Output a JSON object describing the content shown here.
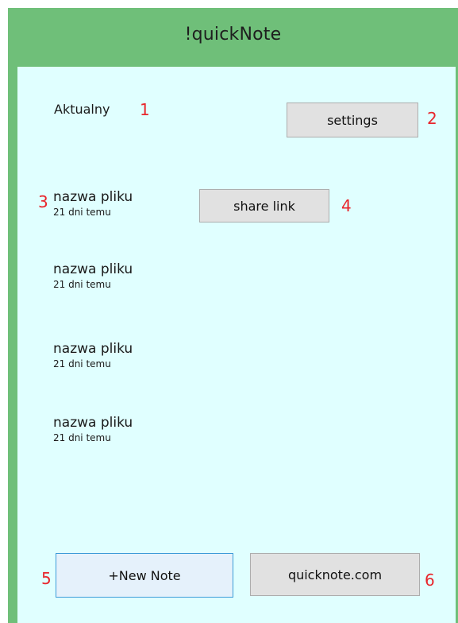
{
  "window": {
    "title": "!quickNote"
  },
  "header": {
    "current_label": "Aktualny",
    "settings_label": "settings"
  },
  "files": [
    {
      "name": "nazwa pliku",
      "date": "21 dni temu"
    },
    {
      "name": "nazwa pliku",
      "date": "21 dni temu"
    },
    {
      "name": "nazwa pliku",
      "date": "21 dni temu"
    },
    {
      "name": "nazwa pliku",
      "date": "21 dni temu"
    }
  ],
  "actions": {
    "share_label": "share link",
    "new_note_label": "+New Note",
    "website_label": "quicknote.com"
  },
  "markers": [
    "1",
    "2",
    "3",
    "4",
    "5",
    "6"
  ],
  "colors": {
    "window_frame": "#6fbf79",
    "client_bg": "#e0ffff",
    "marker": "#e8262c",
    "button_bg": "#e1e1e1",
    "focused_border": "#3c9bd8"
  }
}
